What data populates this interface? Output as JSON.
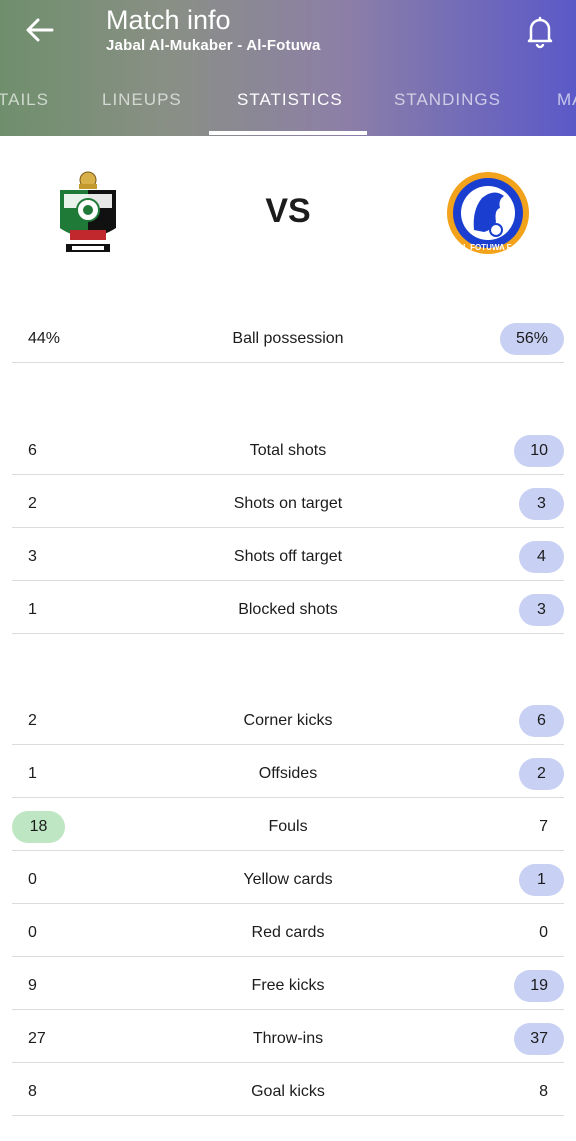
{
  "header": {
    "title": "Match info",
    "subtitle": "Jabal Al-Mukaber - Al-Fotuwa"
  },
  "tabs": [
    {
      "label": "TAILS"
    },
    {
      "label": "LINEUPS"
    },
    {
      "label": "STATISTICS"
    },
    {
      "label": "STANDINGS"
    },
    {
      "label": "MA"
    }
  ],
  "active_tab": "STATISTICS",
  "match": {
    "vs": "VS",
    "away_logo_text": "AL FOTUWA F.C"
  },
  "stats": [
    {
      "label": "Ball possession",
      "home": "44%",
      "away": "56%",
      "winner": "away"
    },
    {
      "label": "Total shots",
      "home": "6",
      "away": "10",
      "winner": "away"
    },
    {
      "label": "Shots on target",
      "home": "2",
      "away": "3",
      "winner": "away"
    },
    {
      "label": "Shots off target",
      "home": "3",
      "away": "4",
      "winner": "away"
    },
    {
      "label": "Blocked shots",
      "home": "1",
      "away": "3",
      "winner": "away"
    },
    {
      "label": "Corner kicks",
      "home": "2",
      "away": "6",
      "winner": "away"
    },
    {
      "label": "Offsides",
      "home": "1",
      "away": "2",
      "winner": "away"
    },
    {
      "label": "Fouls",
      "home": "18",
      "away": "7",
      "winner": "home"
    },
    {
      "label": "Yellow cards",
      "home": "0",
      "away": "1",
      "winner": "away"
    },
    {
      "label": "Red cards",
      "home": "0",
      "away": "0",
      "winner": "none"
    },
    {
      "label": "Free kicks",
      "home": "9",
      "away": "19",
      "winner": "away"
    },
    {
      "label": "Throw-ins",
      "home": "27",
      "away": "37",
      "winner": "away"
    },
    {
      "label": "Goal kicks",
      "home": "8",
      "away": "8",
      "winner": "none"
    }
  ],
  "colors": {
    "home_highlight": "#bfe6c2",
    "away_highlight": "#c8d0f4",
    "header_start": "#6f8f6c",
    "header_end": "#5b59c8"
  }
}
